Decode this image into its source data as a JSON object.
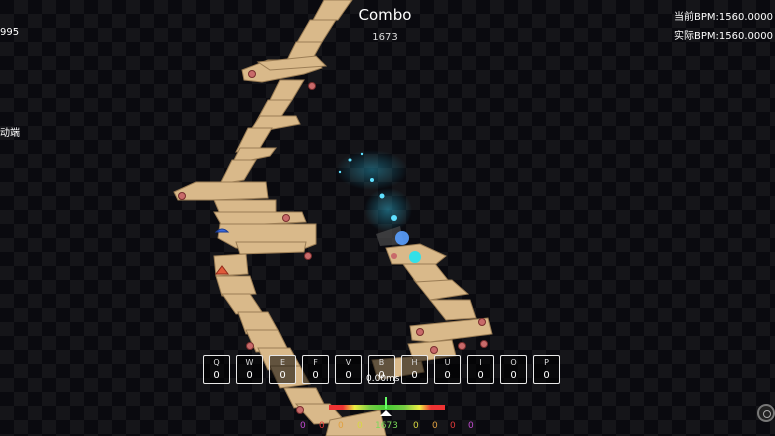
{
  "hud": {
    "combo_title": "Combo",
    "combo_count": "1673",
    "current_bpm": "当前BPM:1560.0000",
    "actual_bpm": "实际BPM:1560.0000",
    "left_number": "995",
    "left_label": "动端",
    "timing_ms": "0.00ms"
  },
  "keys": [
    {
      "label": "Q",
      "count": "0"
    },
    {
      "label": "W",
      "count": "0"
    },
    {
      "label": "E",
      "count": "0"
    },
    {
      "label": "F",
      "count": "0"
    },
    {
      "label": "V",
      "count": "0"
    },
    {
      "label": "B",
      "count": "0"
    },
    {
      "label": "H",
      "count": "0"
    },
    {
      "label": "U",
      "count": "0"
    },
    {
      "label": "I",
      "count": "0"
    },
    {
      "label": "O",
      "count": "0"
    },
    {
      "label": "P",
      "count": "0"
    }
  ],
  "judgements": [
    {
      "value": "0",
      "color": "#c04ad0"
    },
    {
      "value": "0",
      "color": "#e03a3a"
    },
    {
      "value": "0",
      "color": "#e0a040"
    },
    {
      "value": "0",
      "color": "#d8d840"
    },
    {
      "value": "1673",
      "color": "#7ad85a"
    },
    {
      "value": "0",
      "color": "#d8d840"
    },
    {
      "value": "0",
      "color": "#e0a040"
    },
    {
      "value": "0",
      "color": "#e03a3a"
    },
    {
      "value": "0",
      "color": "#c04ad0"
    }
  ],
  "colors": {
    "tile": "#d9b98a",
    "tile_edge": "#9b7d55",
    "planet_ice": "#33e0e8",
    "planet_fire": "#5aa0ff",
    "glow": "#2fb6d8"
  }
}
